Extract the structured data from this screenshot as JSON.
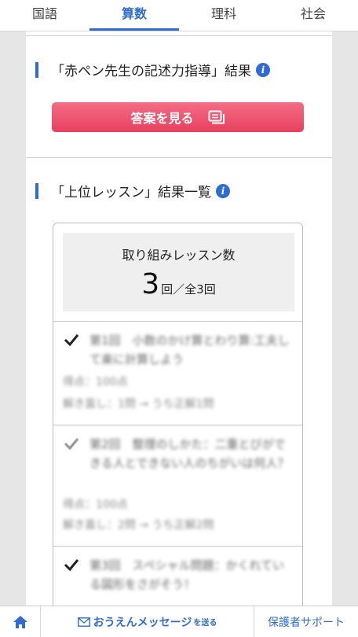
{
  "tabs": [
    {
      "label": "国語"
    },
    {
      "label": "算数"
    },
    {
      "label": "理科"
    },
    {
      "label": "社会"
    }
  ],
  "active_tab": "算数",
  "akapen": {
    "heading": "「赤ペン先生の記述力指導」結果",
    "info_icon": "i",
    "button_label": "答案を見る"
  },
  "lessons_section": {
    "heading": "「上位レッスン」結果一覧",
    "info_icon": "i",
    "count_label": "取り組みレッスン数",
    "count_value": "3",
    "count_suffix": "回／全3回"
  },
  "lessons": [
    {
      "title": "第1回　小数のかけ算とわり算:工夫して楽に計算しよう",
      "score": "得点：100点",
      "retry": "解き直し：1問 → うち正解1問"
    },
    {
      "title": "第2回　整理のしかた：二重とびができる人とできない人のちがいは何人？",
      "score": "得点：100点",
      "retry": "解き直し：2問 → うち正解2問"
    },
    {
      "title": "第3回　スペシャル問題：かくれている図形をさがそう！",
      "score": "",
      "retry": ""
    }
  ],
  "bottom_nav": {
    "home_icon": "home-icon",
    "message_label": "おうえんメッセージ",
    "message_suffix": "を送る",
    "support_label": "保護者サポート"
  },
  "colors": {
    "accent": "#2f6bd0",
    "button": "#ee5572",
    "gutter": "#e6e6e6"
  }
}
